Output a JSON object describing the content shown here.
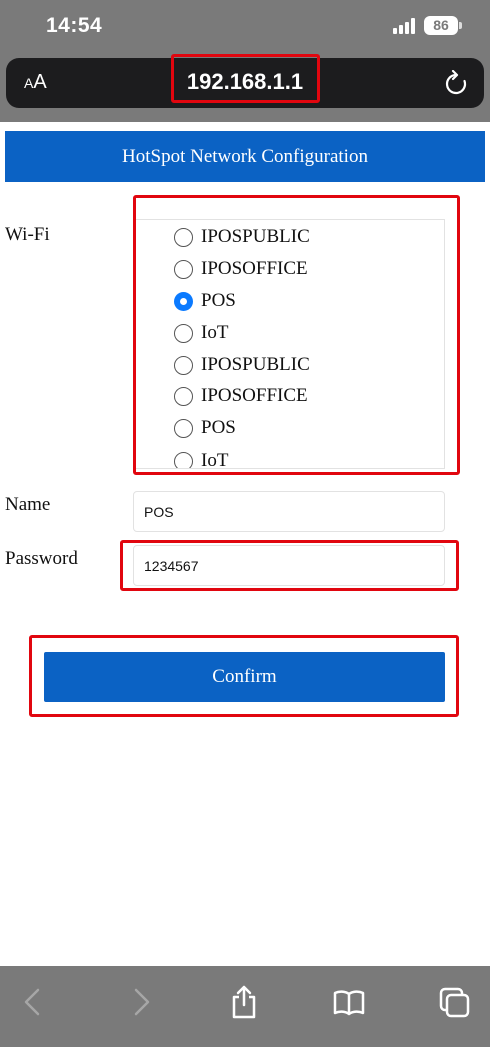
{
  "status_bar": {
    "time": "14:54",
    "battery": "86"
  },
  "browser": {
    "text_size_label_big": "A",
    "text_size_label_small": "A",
    "url": "192.168.1.1"
  },
  "page": {
    "title": "HotSpot Network Configuration",
    "wifi_label": "Wi-Fi",
    "wifi_networks": [
      {
        "name": "IPOSPUBLIC",
        "selected": false
      },
      {
        "name": "IPOSOFFICE",
        "selected": false
      },
      {
        "name": "POS",
        "selected": true
      },
      {
        "name": "IoT",
        "selected": false
      },
      {
        "name": "IPOSPUBLIC",
        "selected": false
      },
      {
        "name": "IPOSOFFICE",
        "selected": false
      },
      {
        "name": "POS",
        "selected": false
      },
      {
        "name": "IoT",
        "selected": false
      }
    ],
    "name_label": "Name",
    "name_value": "POS",
    "password_label": "Password",
    "password_value": "1234567",
    "confirm_label": "Confirm"
  },
  "colors": {
    "accent": "#0b62c4",
    "radio_selected": "#0a7aff",
    "highlight": "#e1060f",
    "chrome": "#7a7a7a"
  },
  "toolbar_icons": [
    "back-icon",
    "forward-icon",
    "share-icon",
    "bookmarks-icon",
    "tabs-icon"
  ]
}
